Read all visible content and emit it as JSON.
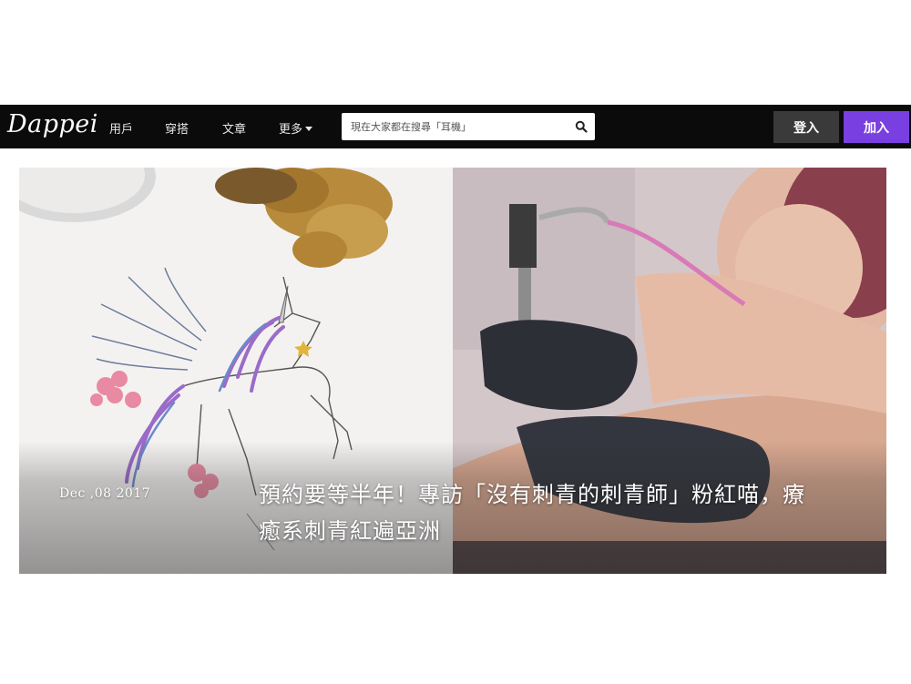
{
  "nav": {
    "logo": "Dappei",
    "links": [
      "用戶",
      "穿搭",
      "文章",
      "更多"
    ],
    "search_placeholder": "現在大家都在搜尋「耳機」",
    "login": "登入",
    "join": "加入"
  },
  "hero": {
    "date": "Dec ,08 2017",
    "title": "預約要等半年！專訪「沒有刺青的刺青師」粉紅喵，療癒系刺青紅遍亞洲"
  },
  "colors": {
    "navbar": "#0b0b0b",
    "login_button": "#3a3a3a",
    "join_button": "#7a3fe0"
  }
}
